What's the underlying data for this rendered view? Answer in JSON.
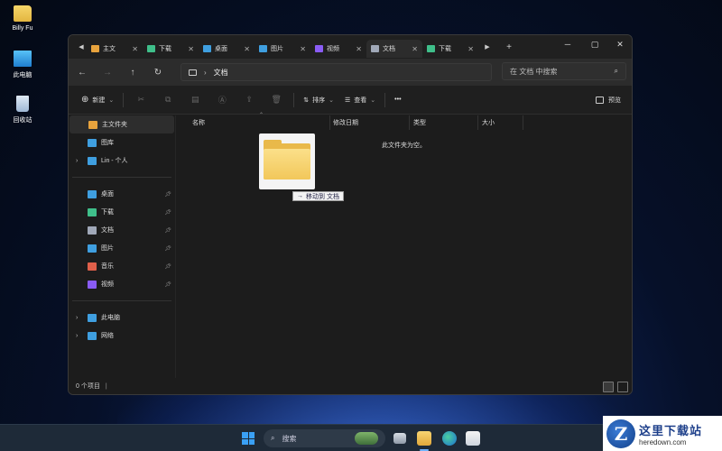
{
  "desktop": {
    "icons": [
      {
        "label": "Billy Fu",
        "icon": "folder-icon"
      },
      {
        "label": "此电脑",
        "icon": "computer-icon"
      },
      {
        "label": "回收站",
        "icon": "recycle-bin-icon"
      }
    ]
  },
  "window": {
    "tabs": [
      {
        "label": "主文",
        "icon": "home-icon",
        "color": "#e8a33d"
      },
      {
        "label": "下载",
        "icon": "download-icon",
        "color": "#3fbf8a"
      },
      {
        "label": "桌面",
        "icon": "desktop-icon",
        "color": "#3f9fe0"
      },
      {
        "label": "图片",
        "icon": "pictures-icon",
        "color": "#3f9fe0"
      },
      {
        "label": "视频",
        "icon": "videos-icon",
        "color": "#8a5cf5"
      },
      {
        "label": "文档",
        "icon": "documents-icon",
        "color": "#a0a8b8"
      },
      {
        "label": "下载",
        "icon": "download-icon",
        "color": "#3fbf8a"
      }
    ],
    "active_tab_index": 5,
    "new_tab_label": "+",
    "address": {
      "path_label": "文档",
      "search_placeholder": "在 文档 中搜索"
    },
    "toolbar": {
      "new_label": "新建",
      "sort_label": "排序",
      "view_label": "查看",
      "more_label": "•••",
      "preview_label": "预览"
    },
    "sidebar": {
      "top_items": [
        {
          "label": "主文件夹",
          "icon": "home-icon",
          "color": "#e8a33d",
          "selected": true
        },
        {
          "label": "图库",
          "icon": "gallery-icon",
          "color": "#3f9fe0"
        },
        {
          "label": "Lin - 个人",
          "icon": "onedrive-icon",
          "color": "#3f9fe0",
          "expandable": true
        }
      ],
      "pinned_items": [
        {
          "label": "桌面",
          "icon": "desktop-icon",
          "color": "#3f9fe0"
        },
        {
          "label": "下载",
          "icon": "download-icon",
          "color": "#3fbf8a"
        },
        {
          "label": "文档",
          "icon": "documents-icon",
          "color": "#a0a8b8"
        },
        {
          "label": "图片",
          "icon": "pictures-icon",
          "color": "#3f9fe0"
        },
        {
          "label": "音乐",
          "icon": "music-icon",
          "color": "#e0604a"
        },
        {
          "label": "视频",
          "icon": "videos-icon",
          "color": "#8a5cf5"
        }
      ],
      "bottom_items": [
        {
          "label": "此电脑",
          "icon": "computer-icon",
          "color": "#3f9fe0"
        },
        {
          "label": "网络",
          "icon": "network-icon",
          "color": "#3f9fe0"
        }
      ]
    },
    "columns": [
      "名称",
      "修改日期",
      "类型",
      "大小"
    ],
    "empty_message": "此文件夹为空。",
    "drag_tooltip": "移动到 文档",
    "status_text": "0 个项目"
  },
  "taskbar": {
    "search_placeholder": "搜索"
  },
  "watermark": {
    "cn": "这里下载站",
    "en": "heredown.com",
    "logo_letter": "Z"
  }
}
